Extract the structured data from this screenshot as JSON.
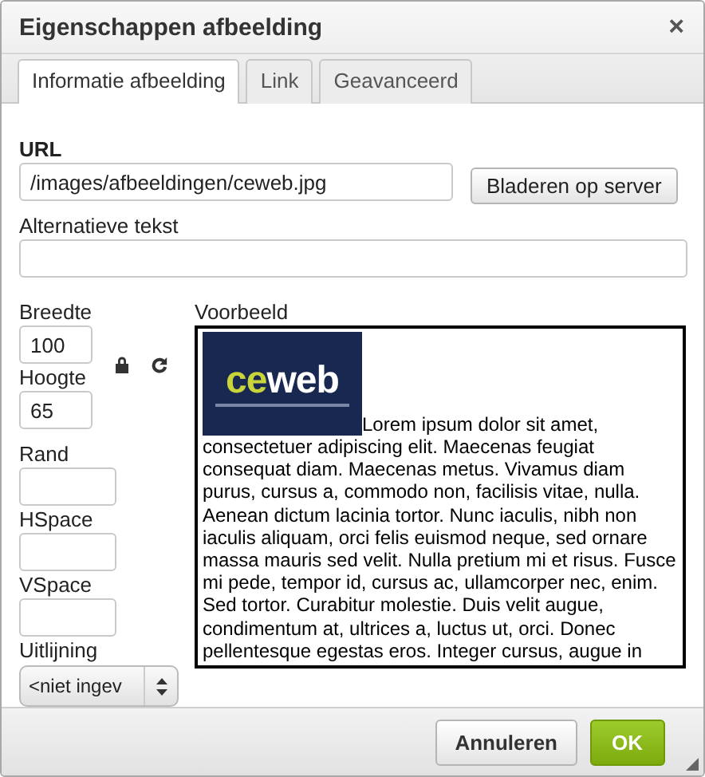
{
  "dialog": {
    "title": "Eigenschappen afbeelding",
    "close": "×"
  },
  "tabs": [
    {
      "label": "Informatie afbeelding",
      "selected": true
    },
    {
      "label": "Link",
      "selected": false
    },
    {
      "label": "Geavanceerd",
      "selected": false
    }
  ],
  "url": {
    "label": "URL",
    "value": "/images/afbeeldingen/ceweb.jpg"
  },
  "browse_button": "Bladeren op server",
  "alt_text": {
    "label": "Alternatieve tekst"
  },
  "width": {
    "label": "Breedte",
    "value": "100"
  },
  "height": {
    "label": "Hoogte",
    "value": "65"
  },
  "border": {
    "label": "Rand"
  },
  "hspace": {
    "label": "HSpace"
  },
  "vspace": {
    "label": "VSpace"
  },
  "align": {
    "label": "Uitlijning",
    "value": "<niet ingev"
  },
  "preview": {
    "label": "Voorbeeld",
    "logo": {
      "accent": "ce",
      "rest": "web"
    },
    "first_line": "Lorem ipsum dolor sit amet,",
    "text": "consectetuer adipiscing elit. Maecenas feugiat consequat diam. Maecenas metus. Vivamus diam purus, cursus a, commodo non, facilisis vitae, nulla. Aenean dictum lacinia tortor. Nunc iaculis, nibh non iaculis aliquam, orci felis euismod neque, sed ornare massa mauris sed velit. Nulla pretium mi et risus. Fusce mi pede, tempor id, cursus ac, ullamcorper nec, enim. Sed tortor. Curabitur molestie. Duis velit augue, condimentum at, ultrices a, luctus ut, orci. Donec pellentesque egestas eros. Integer cursus, augue in"
  },
  "buttons": [
    {
      "label": "Annuleren",
      "kind": "secondary"
    },
    {
      "label": "OK",
      "kind": "primary"
    }
  ]
}
